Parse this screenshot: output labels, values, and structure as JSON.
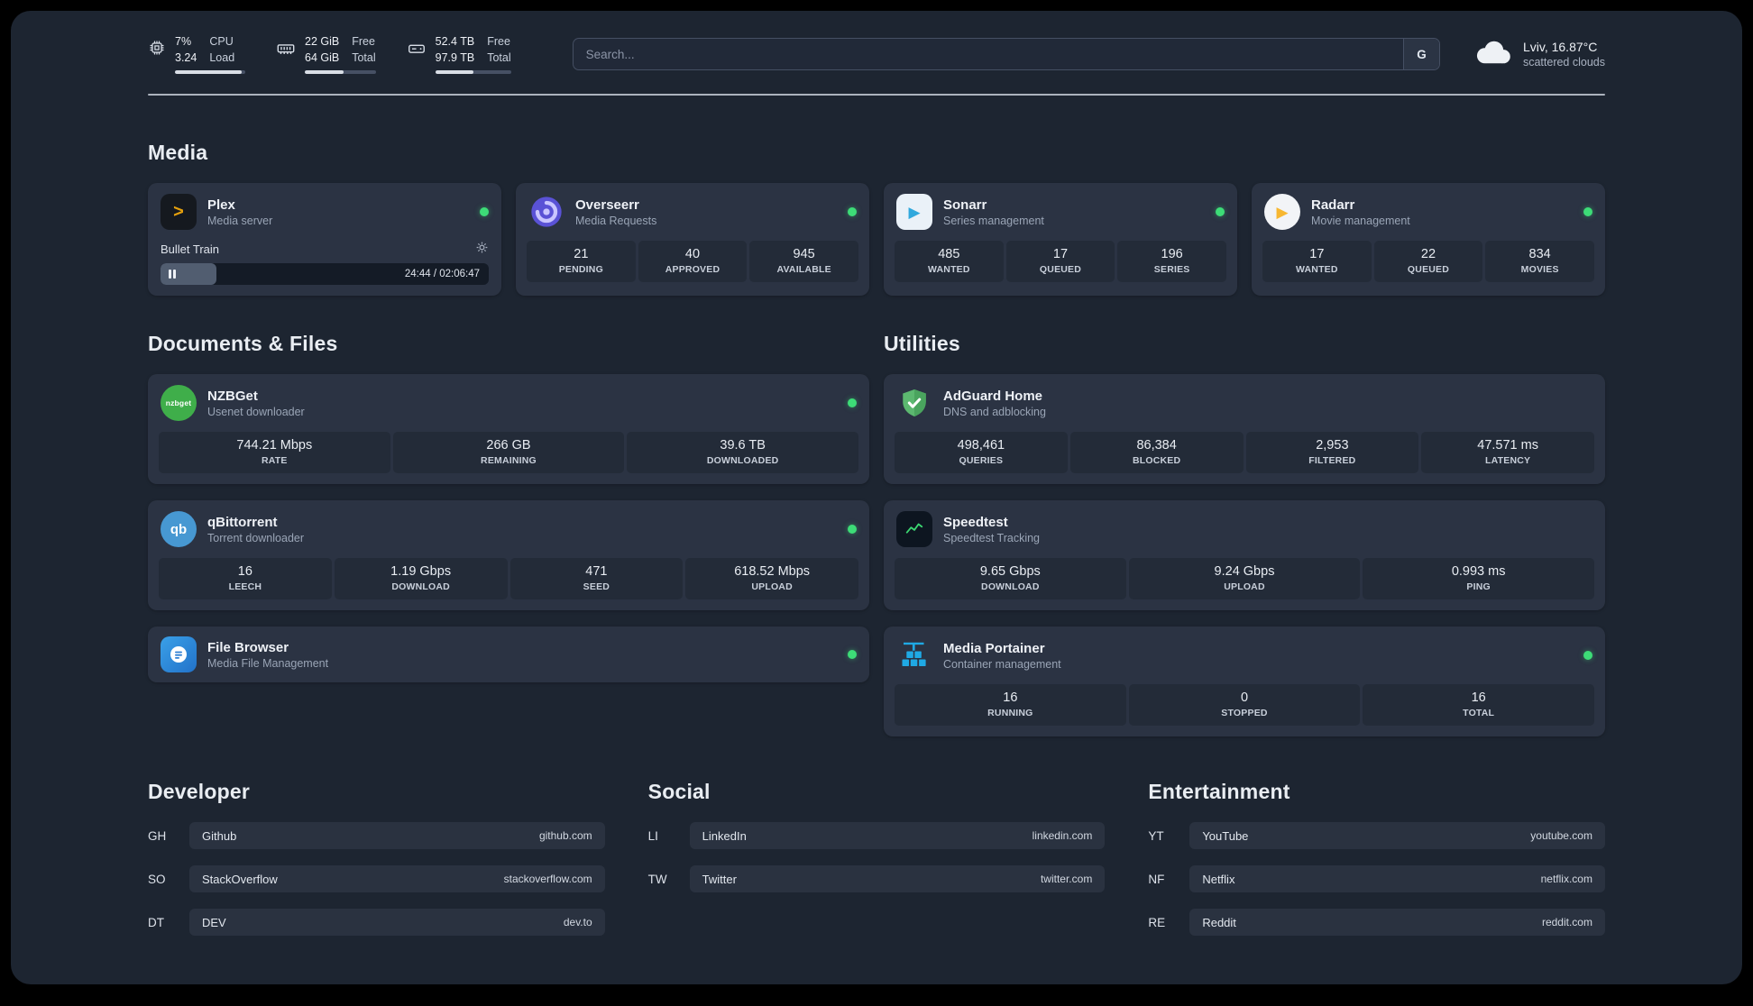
{
  "header": {
    "cpu": {
      "value_top": "7%",
      "value_bottom": "3.24",
      "label_top": "CPU",
      "label_bottom": "Load",
      "bar_pct": 95
    },
    "ram": {
      "value_top": "22 GiB",
      "value_bottom": "64 GiB",
      "label_top": "Free",
      "label_bottom": "Total",
      "bar_pct": 55
    },
    "disk": {
      "value_top": "52.4 TB",
      "value_bottom": "97.9 TB",
      "label_top": "Free",
      "label_bottom": "Total",
      "bar_pct": 50
    },
    "search": {
      "placeholder": "Search...",
      "button": "G"
    },
    "weather": {
      "location": "Lviv, 16.87°C",
      "condition": "scattered clouds"
    }
  },
  "sections": {
    "media": "Media",
    "documents": "Documents & Files",
    "utilities": "Utilities"
  },
  "apps": {
    "plex": {
      "name": "Plex",
      "subtitle": "Media server",
      "player": {
        "track": "Bullet Train",
        "time": "24:44 / 02:06:47",
        "progress_pct": 17
      }
    },
    "overseerr": {
      "name": "Overseerr",
      "subtitle": "Media Requests",
      "stats": [
        {
          "value": "21",
          "label": "PENDING"
        },
        {
          "value": "40",
          "label": "APPROVED"
        },
        {
          "value": "945",
          "label": "AVAILABLE"
        }
      ]
    },
    "sonarr": {
      "name": "Sonarr",
      "subtitle": "Series management",
      "stats": [
        {
          "value": "485",
          "label": "WANTED"
        },
        {
          "value": "17",
          "label": "QUEUED"
        },
        {
          "value": "196",
          "label": "SERIES"
        }
      ]
    },
    "radarr": {
      "name": "Radarr",
      "subtitle": "Movie management",
      "stats": [
        {
          "value": "17",
          "label": "WANTED"
        },
        {
          "value": "22",
          "label": "QUEUED"
        },
        {
          "value": "834",
          "label": "MOVIES"
        }
      ]
    },
    "nzbget": {
      "name": "NZBGet",
      "subtitle": "Usenet downloader",
      "stats": [
        {
          "value": "744.21 Mbps",
          "label": "RATE"
        },
        {
          "value": "266 GB",
          "label": "REMAINING"
        },
        {
          "value": "39.6 TB",
          "label": "DOWNLOADED"
        }
      ]
    },
    "qbittorrent": {
      "name": "qBittorrent",
      "subtitle": "Torrent downloader",
      "stats": [
        {
          "value": "16",
          "label": "LEECH"
        },
        {
          "value": "1.19 Gbps",
          "label": "DOWNLOAD"
        },
        {
          "value": "471",
          "label": "SEED"
        },
        {
          "value": "618.52 Mbps",
          "label": "UPLOAD"
        }
      ]
    },
    "filebrowser": {
      "name": "File Browser",
      "subtitle": "Media File Management"
    },
    "adguard": {
      "name": "AdGuard Home",
      "subtitle": "DNS and adblocking",
      "stats": [
        {
          "value": "498,461",
          "label": "QUERIES"
        },
        {
          "value": "86,384",
          "label": "BLOCKED"
        },
        {
          "value": "2,953",
          "label": "FILTERED"
        },
        {
          "value": "47.571 ms",
          "label": "LATENCY"
        }
      ]
    },
    "speedtest": {
      "name": "Speedtest",
      "subtitle": "Speedtest Tracking",
      "stats": [
        {
          "value": "9.65 Gbps",
          "label": "DOWNLOAD"
        },
        {
          "value": "9.24 Gbps",
          "label": "UPLOAD"
        },
        {
          "value": "0.993 ms",
          "label": "PING"
        }
      ]
    },
    "portainer": {
      "name": "Media Portainer",
      "subtitle": "Container management",
      "stats": [
        {
          "value": "16",
          "label": "RUNNING"
        },
        {
          "value": "0",
          "label": "STOPPED"
        },
        {
          "value": "16",
          "label": "TOTAL"
        }
      ]
    }
  },
  "links": {
    "developer": {
      "title": "Developer",
      "items": [
        {
          "abbr": "GH",
          "name": "Github",
          "domain": "github.com"
        },
        {
          "abbr": "SO",
          "name": "StackOverflow",
          "domain": "stackoverflow.com"
        },
        {
          "abbr": "DT",
          "name": "DEV",
          "domain": "dev.to"
        }
      ]
    },
    "social": {
      "title": "Social",
      "items": [
        {
          "abbr": "LI",
          "name": "LinkedIn",
          "domain": "linkedin.com"
        },
        {
          "abbr": "TW",
          "name": "Twitter",
          "domain": "twitter.com"
        }
      ]
    },
    "entertainment": {
      "title": "Entertainment",
      "items": [
        {
          "abbr": "YT",
          "name": "YouTube",
          "domain": "youtube.com"
        },
        {
          "abbr": "NF",
          "name": "Netflix",
          "domain": "netflix.com"
        },
        {
          "abbr": "RE",
          "name": "Reddit",
          "domain": "reddit.com"
        }
      ]
    }
  },
  "icons": {
    "plex_glyph": ">",
    "sonarr_glyph": "▶",
    "radarr_glyph": "▶",
    "qbittorrent_glyph": "qb",
    "nzbget_glyph": "nzbget"
  },
  "colors": {
    "background": "#1d2531",
    "card": "#2b3343",
    "tile": "#232b38",
    "status_online": "#3ddc77",
    "plex_amber": "#e5a00d",
    "sonarr_blue": "#30a8dd",
    "radarr_yellow": "#f7b731",
    "nzbget_green": "#3fae4a",
    "qbittorrent_blue": "#4798d2",
    "adguard_green": "#5cb870",
    "speedtest_green": "#3bd671",
    "portainer_blue": "#1fa9e4"
  }
}
